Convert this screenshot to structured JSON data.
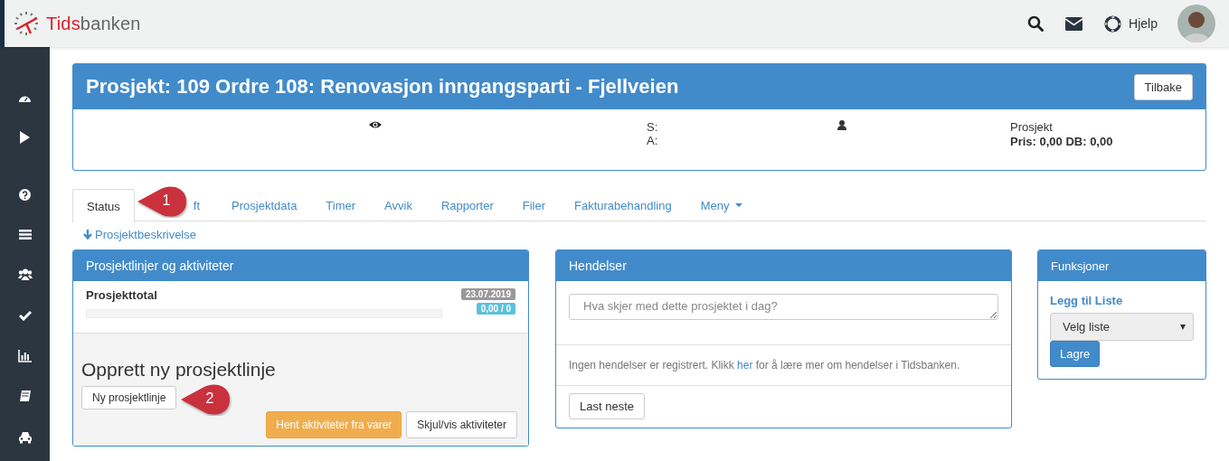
{
  "topbar": {
    "logo": {
      "accent": "Tids",
      "rest": "banken"
    },
    "help_label": "Hjelp"
  },
  "project": {
    "title": "Prosjekt: 109 Ordre 108: Renovasjon inngangsparti - Fjellveien",
    "back_button": "Tilbake",
    "s_label": "S:",
    "a_label": "A:",
    "type": "Prosjekt",
    "price": "Pris: 0,00 DB: 0,00"
  },
  "tabs": [
    {
      "label": "Status",
      "selected": true
    },
    {
      "label": "ft",
      "selected": false
    },
    {
      "label": "Prosjektdata",
      "selected": false
    },
    {
      "label": "Timer",
      "selected": false
    },
    {
      "label": "Avvik",
      "selected": false
    },
    {
      "label": "Rapporter",
      "selected": false
    },
    {
      "label": "Filer",
      "selected": false
    },
    {
      "label": "Fakturabehandling",
      "selected": false
    },
    {
      "label": "Meny",
      "selected": false,
      "kind": "dropdown"
    }
  ],
  "description_link": "Prosjektbeskrivelse",
  "lines_panel": {
    "title": "Prosjektlinjer og aktiviteter",
    "total_label": "Prosjekttotal",
    "date_badge": "23.07.2019",
    "amount_badge": "0,00 / 0",
    "level": 0,
    "create_heading": "Opprett ny prosjektlinje",
    "new_button": "Ny prosjektlinje",
    "fetch_button": "Hent aktiviteter fra varer",
    "toggle_button": "Skjul/vis aktiviteter"
  },
  "events_panel": {
    "title": "Hendelser",
    "placeholder": "Hva skjer med dette prosjektet i dag?",
    "empty_text": "Ingen hendelser er registrert. Klikk ",
    "link": "her",
    "empty_text_end": " for å lære mer om hendelser i Tidsbanken.",
    "load_button": "Last neste"
  },
  "functions_panel": {
    "title": "Funksjoner",
    "heading": "Legg til Liste",
    "select_value": "Velg liste",
    "save_button": "Lagre"
  },
  "callouts": [
    {
      "number": "1"
    },
    {
      "number": "2"
    }
  ]
}
